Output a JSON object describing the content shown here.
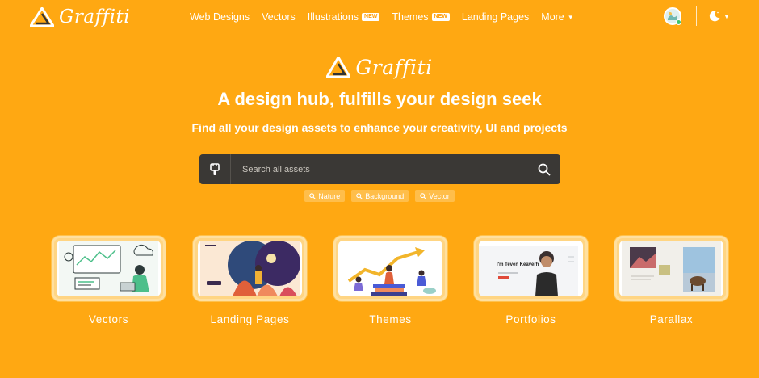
{
  "brand": {
    "name": "Graffiti"
  },
  "nav": {
    "links": [
      {
        "label": "Web Designs"
      },
      {
        "label": "Vectors"
      },
      {
        "label": "Illustrations",
        "badge": "NEW"
      },
      {
        "label": "Themes",
        "badge": "NEW"
      },
      {
        "label": "Landing Pages"
      },
      {
        "label": "More"
      }
    ],
    "icons": {
      "avatar": "user-avatar",
      "theme": "moon-icon",
      "more": "chevron-down-icon"
    }
  },
  "hero": {
    "headline": "A design hub, fulfills your design seek",
    "subline": "Find all your design assets to enhance your creativity, UI and projects"
  },
  "search": {
    "placeholder": "Search all assets",
    "type_icon": "brush-icon",
    "button_icon": "search-icon",
    "tags": [
      "Nature",
      "Background",
      "Vector"
    ]
  },
  "categories": [
    {
      "label": "Vectors",
      "thumb": "vectors-illustration"
    },
    {
      "label": "Landing Pages",
      "thumb": "landing-page-preview"
    },
    {
      "label": "Themes",
      "thumb": "themes-illustration"
    },
    {
      "label": "Portfolios",
      "thumb": "portfolio-preview",
      "thumb_text": "I'm Teven Keaverh"
    },
    {
      "label": "Parallax",
      "thumb": "parallax-preview"
    }
  ],
  "colors": {
    "background": "#FFA812",
    "search_bg": "#3a3835",
    "tag_bg": "#FFBE4A"
  }
}
